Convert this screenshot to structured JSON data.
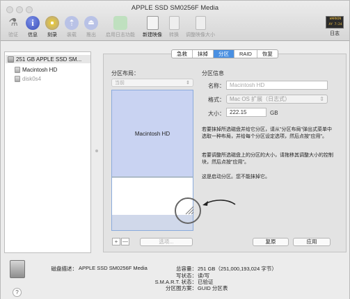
{
  "window": {
    "title": "APPLE SSD SM0256F Media"
  },
  "toolbar": {
    "items": [
      {
        "label": "验证",
        "icon": "microscope-icon"
      },
      {
        "label": "信息",
        "icon": "info-icon"
      },
      {
        "label": "刻录",
        "icon": "burn-icon"
      },
      {
        "label": "装载",
        "icon": "mount-icon"
      },
      {
        "label": "推出",
        "icon": "eject-icon"
      },
      {
        "label": "启用日志功能",
        "icon": "journal-icon"
      },
      {
        "label": "新建映像",
        "icon": "new-image-icon"
      },
      {
        "label": "转换",
        "icon": "convert-icon"
      },
      {
        "label": "调整映像大小",
        "icon": "resize-image-icon"
      }
    ],
    "log": {
      "label": "日志",
      "icon_text": "WARNIN 9:47\nAY 7:24 9:47"
    }
  },
  "sidebar": {
    "items": [
      {
        "label": "251 GB APPLE SSD SM..."
      },
      {
        "label": "Macintosh HD"
      },
      {
        "label": "disk0s4"
      }
    ]
  },
  "tabs": [
    "急救",
    "抹掉",
    "分区",
    "RAID",
    "恢复"
  ],
  "partition": {
    "layout_label": "分区布局：",
    "layout_value": "当前",
    "partition_name": "Macintosh HD",
    "info_label": "分区信息",
    "name_label": "名称：",
    "name_placeholder": "Macintosh HD",
    "format_label": "格式：",
    "format_value": "Mac OS 扩展（日志式）",
    "size_label": "大小：",
    "size_value": "222.15",
    "size_unit": "GB",
    "help1": "若要抹掉所选磁盘并给它分区，请从\"分区布局\"弹出式菜单中选取一种布局，并给每个分区设定选项，然后点按\"应用\"。",
    "help2": "若要调整所选磁盘上的分区的大小，请拖移其调整大小的控制块，然后点按\"应用\"。",
    "help3": "这是启动分区。您不能抹掉它。",
    "plus": "+",
    "minus": "—",
    "options_button": "选项...",
    "revert_button": "复原",
    "apply_button": "应用"
  },
  "disk_info": {
    "desc_label": "磁盘描述：",
    "desc_value": "APPLE SSD SM0256F Media",
    "capacity_label": "总容量：",
    "capacity_value": "251 GB（251,000,193,024 字节）",
    "write_label": "写状态：",
    "write_value": "读/写",
    "smart_label": "S.M.A.R.T. 状态：",
    "smart_value": "已验证",
    "scheme_label": "分区图方案：",
    "scheme_value": "GUID 分区表"
  },
  "help_button": "?"
}
